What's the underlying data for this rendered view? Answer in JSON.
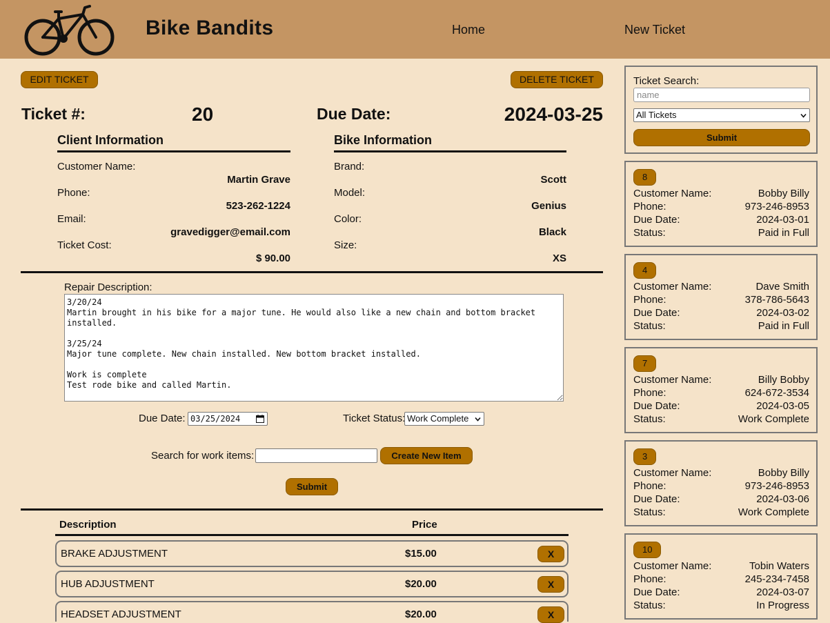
{
  "header": {
    "brand": "Bike Bandits",
    "nav": {
      "home": "Home",
      "new_ticket": "New Ticket"
    }
  },
  "actions": {
    "edit": "EDIT TICKET",
    "delete": "DELETE TICKET"
  },
  "ticket": {
    "number_label": "Ticket #:",
    "number": "20",
    "due_label": "Due Date:",
    "due": "2024-03-25"
  },
  "client": {
    "title": "Client Information",
    "name_label": "Customer Name:",
    "name": "Martin Grave",
    "phone_label": "Phone:",
    "phone": "523-262-1224",
    "email_label": "Email:",
    "email": "gravedigger@email.com",
    "cost_label": "Ticket Cost:",
    "cost": "$ 90.00"
  },
  "bike": {
    "title": "Bike Information",
    "brand_label": "Brand:",
    "brand": "Scott",
    "model_label": "Model:",
    "model": "Genius",
    "color_label": "Color:",
    "color": "Black",
    "size_label": "Size:",
    "size": "XS"
  },
  "repair": {
    "label": "Repair Description:",
    "text": "3/20/24\nMartin brought in his bike for a major tune. He would also like a new chain and bottom bracket installed.\n\n3/25/24\nMajor tune complete. New chain installed. New bottom bracket installed.\n\nWork is complete\nTest rode bike and called Martin."
  },
  "form": {
    "due_label": "Due Date:",
    "due_value": "03/25/2024",
    "status_label": "Ticket Status:",
    "status_value": "Work Complete",
    "search_label": "Search for work items:",
    "search_value": "",
    "create_label": "Create New Item",
    "submit_label": "Submit"
  },
  "items_table": {
    "col_description": "Description",
    "col_price": "Price",
    "remove_label": "X",
    "rows": [
      {
        "description": "BRAKE ADJUSTMENT",
        "price": "$15.00"
      },
      {
        "description": "HUB ADJUSTMENT",
        "price": "$20.00"
      },
      {
        "description": "HEADSET ADJUSTMENT",
        "price": "$20.00"
      }
    ]
  },
  "sidebar": {
    "search_label": "Ticket Search:",
    "name_placeholder": "name",
    "filter_value": "All Tickets",
    "submit_label": "Submit",
    "labels": {
      "customer": "Customer Name:",
      "phone": "Phone:",
      "due": "Due Date:",
      "status": "Status:"
    },
    "cards": [
      {
        "id": "8",
        "customer": "Bobby Billy",
        "phone": "973-246-8953",
        "due": "2024-03-01",
        "status": "Paid in Full"
      },
      {
        "id": "4",
        "customer": "Dave Smith",
        "phone": "378-786-5643",
        "due": "2024-03-02",
        "status": "Paid in Full"
      },
      {
        "id": "7",
        "customer": "Billy Bobby",
        "phone": "624-672-3534",
        "due": "2024-03-05",
        "status": "Work Complete"
      },
      {
        "id": "3",
        "customer": "Bobby Billy",
        "phone": "973-246-8953",
        "due": "2024-03-06",
        "status": "Work Complete"
      },
      {
        "id": "10",
        "customer": "Tobin Waters",
        "phone": "245-234-7458",
        "due": "2024-03-07",
        "status": "In Progress"
      }
    ]
  }
}
